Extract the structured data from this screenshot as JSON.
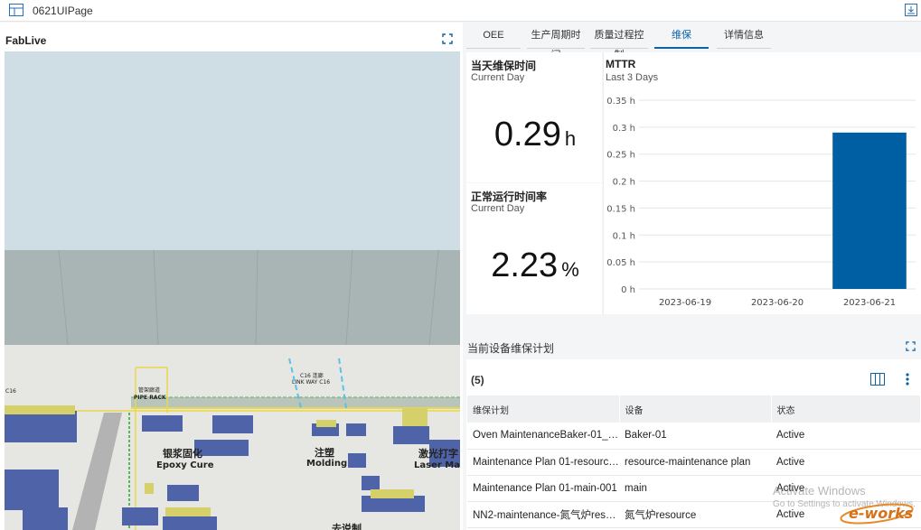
{
  "app": {
    "title": "0621UIPage"
  },
  "left_panel": {
    "title": "FabLive"
  },
  "scene_labels": {
    "pipe_rack_cn": "管架廊道",
    "pipe_rack_en": "PIPE RACK",
    "link_way_cn": "C16 连廊",
    "link_way_en": "LINK WAY C16",
    "epoxy_cn": "银浆固化",
    "epoxy_en": "Epoxy Cure",
    "molding_cn": "注塑",
    "molding_en": "Molding",
    "laser_cn": "激光打字",
    "laser_en": "Laser Ma",
    "c16": "C16",
    "bottom_cn": "去说制"
  },
  "tabs": [
    {
      "label": "OEE",
      "active": false
    },
    {
      "label": "生产周期时间",
      "active": false
    },
    {
      "label": "质量过程控制",
      "active": false
    },
    {
      "label": "维保",
      "active": true
    },
    {
      "label": "详情信息",
      "active": false
    }
  ],
  "kpi_maintenance_time": {
    "title": "当天维保时间",
    "subtitle": "Current Day",
    "value": "0.29",
    "unit": "h"
  },
  "kpi_uptime": {
    "title": "正常运行时间率",
    "subtitle": "Current Day",
    "value": "2.23",
    "unit": "%"
  },
  "chart_data": {
    "type": "bar",
    "title": "MTTR",
    "subtitle": "Last 3 Days",
    "categories": [
      "2023-06-19",
      "2023-06-20",
      "2023-06-21"
    ],
    "values": [
      0,
      0,
      0.29
    ],
    "y_ticks": [
      "0 h",
      "0.05 h",
      "0.1 h",
      "0.15 h",
      "0.2 h",
      "0.25 h",
      "0.3 h",
      "0.35 h"
    ],
    "ylim": [
      0,
      0.35
    ],
    "grid": true,
    "bar_color": "#005fa3"
  },
  "maintenance_plan": {
    "title": "当前设备维保计划",
    "count": "(5)",
    "columns": [
      "维保计划",
      "设备",
      "状态"
    ],
    "rows": [
      [
        "Oven MaintenanceBaker-01_2...",
        "Baker-01",
        "Active"
      ],
      [
        "Maintenance Plan 01-resource...",
        "resource-maintenance plan",
        "Active"
      ],
      [
        "Maintenance Plan 01-main-001",
        "main",
        "Active"
      ],
      [
        "NN2-maintenance-氮气炉reso...",
        "氮气炉resource",
        "Active"
      ]
    ]
  },
  "watermark": {
    "line1": "Activate Windows",
    "line2": "Go to Settings to activate Windows."
  },
  "logo_text": "e-works",
  "colors": {
    "accent": "#0a62a8"
  }
}
